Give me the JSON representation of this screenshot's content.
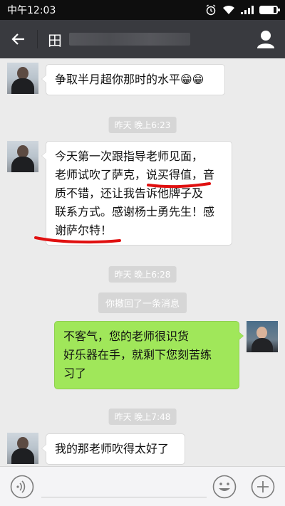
{
  "status_bar": {
    "time": "中午12:03"
  },
  "header": {
    "title": "田",
    "back_icon": "arrow-left-icon",
    "profile_icon": "person-icon"
  },
  "messages": [
    {
      "type": "received",
      "text": "争取半月超你那时的水平😁😁"
    },
    {
      "type": "timestamp",
      "text": "昨天 晚上6:23"
    },
    {
      "type": "received",
      "lines": [
        "今天第一次跟指导老师见面，",
        "老师试吹了萨克，说买得值，音",
        "质不错，还让我告诉他牌子及",
        "联系方式。感谢杨士勇先生！感",
        "谢萨尔特！"
      ]
    },
    {
      "type": "timestamp",
      "text": "昨天 晚上6:28"
    },
    {
      "type": "system",
      "text": "你撤回了一条消息"
    },
    {
      "type": "sent",
      "lines": [
        "不客气，您的老师很识货",
        "好乐器在手，就剩下您刻苦练",
        "习了"
      ]
    },
    {
      "type": "timestamp",
      "text": "昨天 晚上7:48"
    },
    {
      "type": "received",
      "text": "我的那老师吹得太好了"
    }
  ],
  "input_bar": {
    "placeholder": "",
    "voice_icon": "voice-icon",
    "emoji_icon": "emoji-icon",
    "plus_icon": "plus-icon"
  },
  "colors": {
    "header_bg": "#393a3f",
    "chat_bg": "#ebebeb",
    "sent_bubble": "#a0e75a",
    "annotation": "#e01010"
  }
}
